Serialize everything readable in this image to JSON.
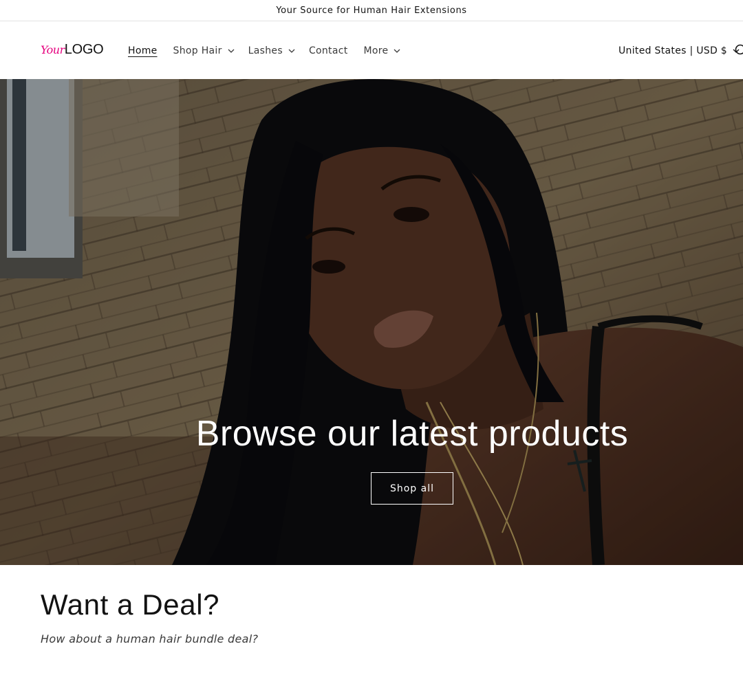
{
  "announcement": {
    "text": "Your Source for Human Hair Extensions"
  },
  "header": {
    "logo": {
      "part1": "Your",
      "part2": "LOGO"
    },
    "nav": [
      {
        "label": "Home",
        "active": true,
        "has_dropdown": false
      },
      {
        "label": "Shop Hair",
        "active": false,
        "has_dropdown": true
      },
      {
        "label": "Lashes",
        "active": false,
        "has_dropdown": true
      },
      {
        "label": "Contact",
        "active": false,
        "has_dropdown": false
      },
      {
        "label": "More",
        "active": false,
        "has_dropdown": true
      }
    ],
    "country_selector": {
      "label": "United States | USD $",
      "icon": "chevron-down-icon"
    },
    "search": {
      "icon": "search-icon"
    }
  },
  "hero": {
    "heading": "Browse our latest products",
    "button_label": "Shop all",
    "image_description_icon": "hero-photo"
  },
  "deal": {
    "title": "Want a Deal?",
    "subtitle": "How about a human hair bundle deal?"
  },
  "colors": {
    "logo_accent": "#e6007e",
    "text": "#121212",
    "border": "#e3e3e3"
  }
}
